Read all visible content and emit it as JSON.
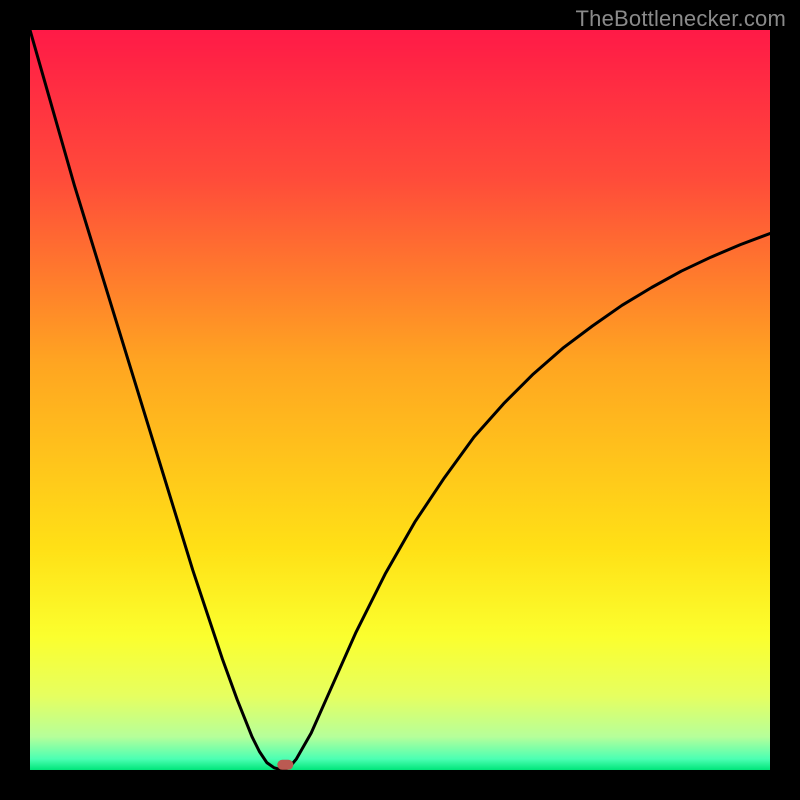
{
  "watermark": "TheBottlenecker.com",
  "chart_data": {
    "type": "line",
    "title": "",
    "xlabel": "",
    "ylabel": "",
    "xlim": [
      0,
      100
    ],
    "ylim": [
      0,
      100
    ],
    "grid": false,
    "curve_note": "V-shaped bottleneck curve; y≈0 at the trough, rising sharply on both sides. Values estimated from pixel positions; no axis ticks present.",
    "x": [
      0,
      2,
      4,
      6,
      8,
      10,
      12,
      14,
      16,
      18,
      20,
      22,
      24,
      26,
      28,
      30,
      31,
      32,
      33,
      34,
      35,
      36,
      38,
      40,
      44,
      48,
      52,
      56,
      60,
      64,
      68,
      72,
      76,
      80,
      84,
      88,
      92,
      96,
      100
    ],
    "y": [
      100,
      93,
      86,
      79,
      72.5,
      66,
      59.5,
      53,
      46.5,
      40,
      33.5,
      27,
      21,
      15,
      9.5,
      4.5,
      2.5,
      1.0,
      0.3,
      0.0,
      0.3,
      1.5,
      5.0,
      9.5,
      18.5,
      26.5,
      33.5,
      39.5,
      45.0,
      49.5,
      53.5,
      57.0,
      60.0,
      62.8,
      65.2,
      67.4,
      69.3,
      71.0,
      72.5
    ],
    "trough": {
      "x": 34,
      "y": 0
    },
    "marker": {
      "x": 34.5,
      "y": 0.7,
      "color": "#bb5a52",
      "shape": "rounded-rect"
    },
    "background_gradient": {
      "type": "vertical",
      "stops": [
        {
          "pos": 0.0,
          "color": "#ff1a47"
        },
        {
          "pos": 0.2,
          "color": "#ff4b3a"
        },
        {
          "pos": 0.45,
          "color": "#ffa521"
        },
        {
          "pos": 0.7,
          "color": "#ffe016"
        },
        {
          "pos": 0.82,
          "color": "#fbff2e"
        },
        {
          "pos": 0.9,
          "color": "#e6ff60"
        },
        {
          "pos": 0.955,
          "color": "#b6ff9a"
        },
        {
          "pos": 0.985,
          "color": "#4cffb3"
        },
        {
          "pos": 1.0,
          "color": "#00e57a"
        }
      ]
    }
  }
}
